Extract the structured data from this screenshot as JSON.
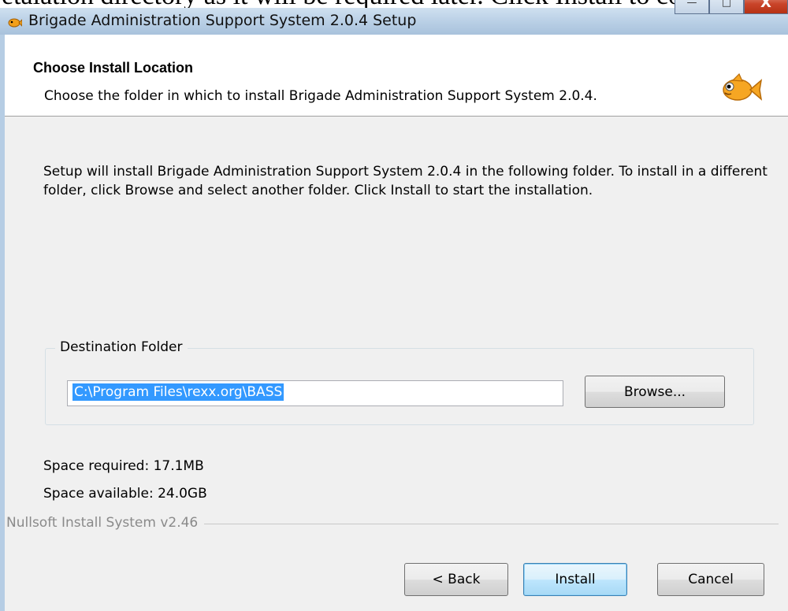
{
  "window": {
    "title": "Brigade Administration Support System 2.0.4 Setup",
    "caption_buttons": {
      "minimize": "—",
      "maximize": "□",
      "close": "X"
    }
  },
  "background_cut_text": "etalation directory as it will be required later. Click Install to continue.",
  "header": {
    "title": "Choose Install Location",
    "subtitle": "Choose the folder in which to install Brigade Administration Support System 2.0.4."
  },
  "body": {
    "instructions": "Setup will install Brigade Administration Support System 2.0.4 in the following folder. To install in a different folder, click Browse and select another folder. Click Install to start the installation."
  },
  "destination": {
    "legend": "Destination Folder",
    "path": "C:\\Program Files\\rexx.org\\BASS",
    "browse_label": "Browse..."
  },
  "space": {
    "required": "Space required: 17.1MB",
    "available": "Space available: 24.0GB"
  },
  "footer": {
    "branding": "Nullsoft Install System v2.46",
    "back_label": "< Back",
    "install_label": "Install",
    "cancel_label": "Cancel"
  },
  "colors": {
    "selection": "#3399ff",
    "dialog_bg": "#f0f0f0",
    "titlebar": "#b6cde4"
  }
}
